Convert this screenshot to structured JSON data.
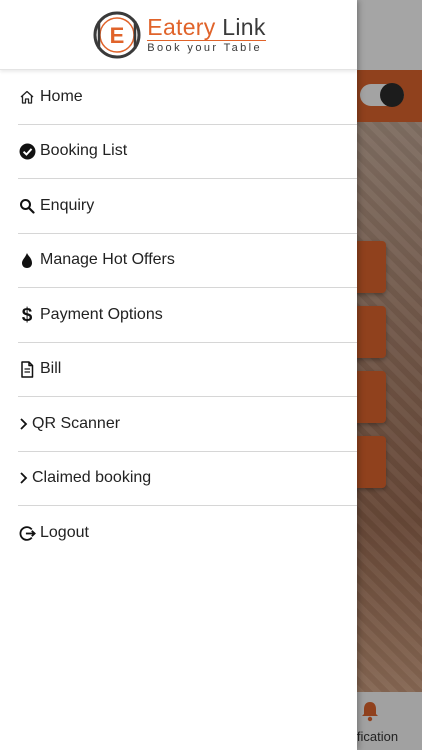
{
  "brand": {
    "name_part1": "Eatery",
    "name_part2": "Link",
    "tagline": "Book your Table",
    "logo_letter": "E",
    "accent_color": "#e0632a"
  },
  "drawer": {
    "items": [
      {
        "label": "Home",
        "icon": "home-icon"
      },
      {
        "label": "Booking List",
        "icon": "check-circle-icon"
      },
      {
        "label": "Enquiry",
        "icon": "search-icon"
      },
      {
        "label": "Manage Hot Offers",
        "icon": "flame-icon"
      },
      {
        "label": "Payment Options",
        "icon": "dollar-icon"
      },
      {
        "label": "Bill",
        "icon": "document-icon"
      },
      {
        "label": "QR Scanner",
        "icon": "chevron-right-icon"
      },
      {
        "label": "Claimed booking",
        "icon": "chevron-right-icon"
      },
      {
        "label": "Logout",
        "icon": "logout-icon"
      }
    ]
  },
  "background": {
    "toggle_on": true,
    "footer_tab_label": "ification",
    "footer_tab_icon": "bell-icon",
    "header_color": "#d5612b"
  }
}
